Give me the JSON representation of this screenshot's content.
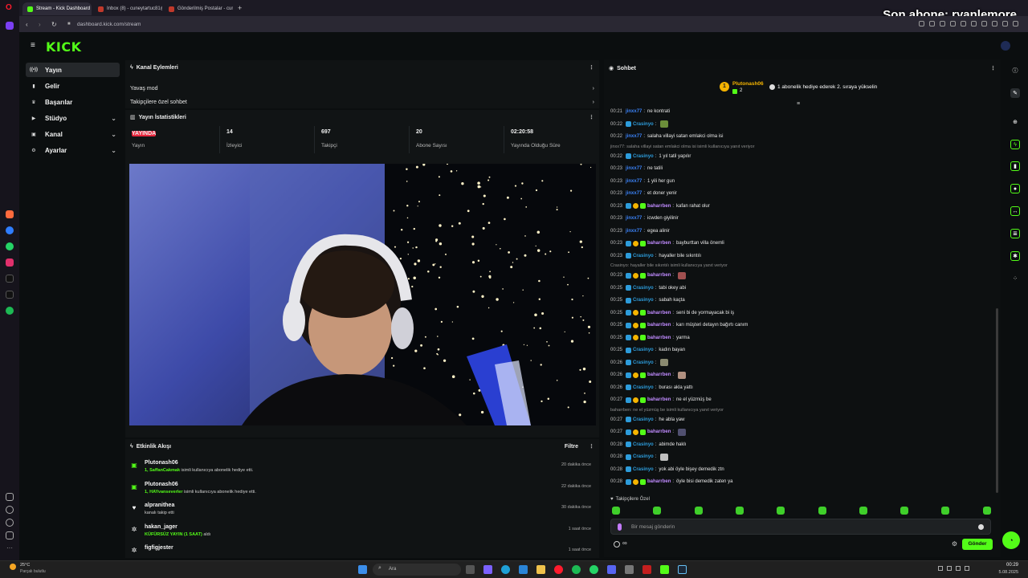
{
  "browser": {
    "tabs": [
      {
        "label": "Stream - Kick Dashboard",
        "color": "#53fc18",
        "active": true
      },
      {
        "label": "Inbox (8) - cuneytartuc81@...",
        "color": "#c0392b",
        "active": false
      },
      {
        "label": "Gönderilmiş Postalar - cun...",
        "color": "#c0392b",
        "active": false
      }
    ],
    "new_tab": "+",
    "url": "dashboard.kick.com/stream"
  },
  "stream_overlay": {
    "text": "Son abone: ryanlemore"
  },
  "app": {
    "logo": "KICK"
  },
  "nav": {
    "items": [
      {
        "label": "Yayın",
        "icon": "broadcast-icon",
        "glyph": "((•))",
        "selected": true,
        "chevron": false
      },
      {
        "label": "Gelir",
        "icon": "money-icon",
        "glyph": "▮",
        "selected": false,
        "chevron": false
      },
      {
        "label": "Başarılar",
        "icon": "trophy-icon",
        "glyph": "♛",
        "selected": false,
        "chevron": false
      },
      {
        "label": "Stüdyo",
        "icon": "studio-icon",
        "glyph": "▶",
        "selected": false,
        "chevron": true
      },
      {
        "label": "Kanal",
        "icon": "channel-icon",
        "glyph": "▣",
        "selected": false,
        "chevron": true
      },
      {
        "label": "Ayarlar",
        "icon": "gear-icon",
        "glyph": "⚙",
        "selected": false,
        "chevron": true
      }
    ]
  },
  "channel_actions": {
    "title": "Kanal Eylemleri",
    "rows": [
      "Yavaş mod",
      "Takipçilere özel sohbet"
    ]
  },
  "stats": {
    "title": "Yayın İstatistikleri",
    "live_badge": "YAYINDA",
    "items": [
      {
        "value": "",
        "label": "Yayın"
      },
      {
        "value": "14",
        "label": "İzleyici"
      },
      {
        "value": "697",
        "label": "Takipçi"
      },
      {
        "value": "20",
        "label": "Abone Sayısı"
      },
      {
        "value": "02:20:58",
        "label": "Yayında Olduğu Süre"
      }
    ]
  },
  "activity": {
    "title": "Etkinlik Akışı",
    "filter": "Filtre",
    "items": [
      {
        "icon": "gift-icon",
        "name": "Plutonash06",
        "desc_hl": "1, SaffanCakmak",
        "desc": " isimli kullanıcıya abonelik hediye etti.",
        "time": "20 dakika önce",
        "color": "#53fc18"
      },
      {
        "icon": "gift-icon",
        "name": "Plutonash06",
        "desc_hl": "1, HAYvanseverler",
        "desc": " isimli kullanıcıya abonelik hediye etti.",
        "time": "22 dakika önce",
        "color": "#53fc18"
      },
      {
        "icon": "heart-icon",
        "name": "alpranithea",
        "desc_hl": "",
        "desc": "kanalı takip etti",
        "time": "30 dakika önce",
        "color": "#ffffff"
      },
      {
        "icon": "reward-icon",
        "name": "hakan_jager",
        "desc_hl": "KÜFÜRSÜZ YAYIN (1 SAAT)",
        "desc": " aldı",
        "time": "1 saat önce",
        "color": "#ffffff"
      },
      {
        "icon": "reward-icon",
        "name": "figfigjester",
        "desc_hl": "",
        "desc": "",
        "time": "1 saat önce",
        "color": "#ffffff"
      }
    ]
  },
  "chat": {
    "title": "Sohbet",
    "pinned": {
      "rank": "1",
      "user": "Plutonash06",
      "count": "2",
      "message": "1 abonelik hediye ederek 2. sıraya yükselin"
    },
    "followers_only": "Takipçilere Özel",
    "input_placeholder": "Bir mesaj gönderin",
    "send_label": "Gönder",
    "points": "∞",
    "messages": [
      {
        "type": "msg",
        "time": "00:21",
        "user": "jinxx77",
        "color": "#3b82f6",
        "badges": 0,
        "text": "ne kontrati",
        "emote": false
      },
      {
        "type": "msg",
        "time": "00:22",
        "user": "Crasinyo",
        "color": "#2d9cdb",
        "badges": 1,
        "text": "",
        "emote": true
      },
      {
        "type": "msg",
        "time": "00:22",
        "user": "jinxx77",
        "color": "#3b82f6",
        "badges": 0,
        "text": "salaha villayi satan emlakci olma isi",
        "emote": false
      },
      {
        "type": "reply",
        "text": "jinxx77: salaha villayi satan emlakci olma isi isimli kullanıcıya yanıt veriyor"
      },
      {
        "type": "msg",
        "time": "00:22",
        "user": "Crasinyo",
        "color": "#2d9cdb",
        "badges": 1,
        "text": "1 yıl tatil yapılır",
        "emote": false
      },
      {
        "type": "msg",
        "time": "00:23",
        "user": "jinxx77",
        "color": "#3b82f6",
        "badges": 0,
        "text": "ne tatili",
        "emote": false
      },
      {
        "type": "msg",
        "time": "00:23",
        "user": "jinxx77",
        "color": "#3b82f6",
        "badges": 0,
        "text": "1 yili her gun",
        "emote": false
      },
      {
        "type": "msg",
        "time": "00:23",
        "user": "jinxx77",
        "color": "#3b82f6",
        "badges": 0,
        "text": "et doner yenir",
        "emote": false
      },
      {
        "type": "msg",
        "time": "00:23",
        "user": "baharrben",
        "color": "#c08bff",
        "badges": 3,
        "text": "kafan rahat olur",
        "emote": false
      },
      {
        "type": "msg",
        "time": "00:23",
        "user": "jinxx77",
        "color": "#3b82f6",
        "badges": 0,
        "text": "icwden giyilinir",
        "emote": false
      },
      {
        "type": "msg",
        "time": "00:23",
        "user": "jinxx77",
        "color": "#3b82f6",
        "badges": 0,
        "text": "egea alinir",
        "emote": false
      },
      {
        "type": "msg",
        "time": "00:23",
        "user": "baharrben",
        "color": "#c08bff",
        "badges": 3,
        "text": "bayburttan villa önemli",
        "emote": false
      },
      {
        "type": "msg",
        "time": "00:23",
        "user": "Crasinyo",
        "color": "#2d9cdb",
        "badges": 1,
        "text": "hayaller bile sıkıntılı",
        "emote": false
      },
      {
        "type": "reply",
        "text": "Crasinyo: hayaller bile sıkıntılı isimli kullanıcıya yanıt veriyor"
      },
      {
        "type": "msg",
        "time": "00:23",
        "user": "baharrben",
        "color": "#c08bff",
        "badges": 3,
        "text": "",
        "emote": true
      },
      {
        "type": "msg",
        "time": "00:25",
        "user": "Crasinyo",
        "color": "#2d9cdb",
        "badges": 1,
        "text": "tabi okey abi",
        "emote": false
      },
      {
        "type": "msg",
        "time": "00:25",
        "user": "Crasinyo",
        "color": "#2d9cdb",
        "badges": 1,
        "text": "sabah kaçta",
        "emote": false
      },
      {
        "type": "msg",
        "time": "00:25",
        "user": "baharrben",
        "color": "#c08bff",
        "badges": 3,
        "text": "seni bi de yormayacak bi iş",
        "emote": false
      },
      {
        "type": "msg",
        "time": "00:25",
        "user": "baharrben",
        "color": "#c08bff",
        "badges": 3,
        "text": "karı müşteri detayın bağırtı canım",
        "emote": false
      },
      {
        "type": "msg",
        "time": "00:25",
        "user": "baharrben",
        "color": "#c08bff",
        "badges": 3,
        "text": "yarma",
        "emote": false
      },
      {
        "type": "msg",
        "time": "00:25",
        "user": "Crasinyo",
        "color": "#2d9cdb",
        "badges": 1,
        "text": "kadın bayan",
        "emote": false
      },
      {
        "type": "msg",
        "time": "00:26",
        "user": "Crasinyo",
        "color": "#2d9cdb",
        "badges": 1,
        "text": "",
        "emote": true
      },
      {
        "type": "msg",
        "time": "00:26",
        "user": "baharrben",
        "color": "#c08bff",
        "badges": 3,
        "text": "",
        "emote": true
      },
      {
        "type": "msg",
        "time": "00:26",
        "user": "Crasinyo",
        "color": "#2d9cdb",
        "badges": 1,
        "text": "burası akla yattı",
        "emote": false
      },
      {
        "type": "msg",
        "time": "00:27",
        "user": "baharrben",
        "color": "#c08bff",
        "badges": 3,
        "text": "ne el yüzmüş be",
        "emote": false
      },
      {
        "type": "reply",
        "text": "baharrben: ne el yüzmüş be isimli kullanıcıya yanıt veriyor"
      },
      {
        "type": "msg",
        "time": "00:27",
        "user": "Crasinyo",
        "color": "#2d9cdb",
        "badges": 1,
        "text": "he abla yaw",
        "emote": false
      },
      {
        "type": "msg",
        "time": "00:27",
        "user": "baharrben",
        "color": "#c08bff",
        "badges": 3,
        "text": "",
        "emote": true
      },
      {
        "type": "msg",
        "time": "00:28",
        "user": "Crasinyo",
        "color": "#2d9cdb",
        "badges": 1,
        "text": "abimde haklı",
        "emote": false
      },
      {
        "type": "msg",
        "time": "00:28",
        "user": "Crasinyo",
        "color": "#2d9cdb",
        "badges": 1,
        "text": "",
        "emote": true
      },
      {
        "type": "msg",
        "time": "00:28",
        "user": "Crasinyo",
        "color": "#2d9cdb",
        "badges": 1,
        "text": "yok abi öyle bişey demedik ztn",
        "emote": false
      },
      {
        "type": "msg",
        "time": "00:28",
        "user": "baharrben",
        "color": "#c08bff",
        "badges": 3,
        "text": "öyle bisi demedik zaten ya",
        "emote": false
      }
    ]
  },
  "taskbar": {
    "weather_temp": "25°C",
    "weather_desc": "Parçalı bulutlu",
    "search_label": "Ara",
    "time": "00:29",
    "date": "5.08.2025"
  },
  "colors": {
    "accent": "#53fc18",
    "live": "#e8263d"
  }
}
